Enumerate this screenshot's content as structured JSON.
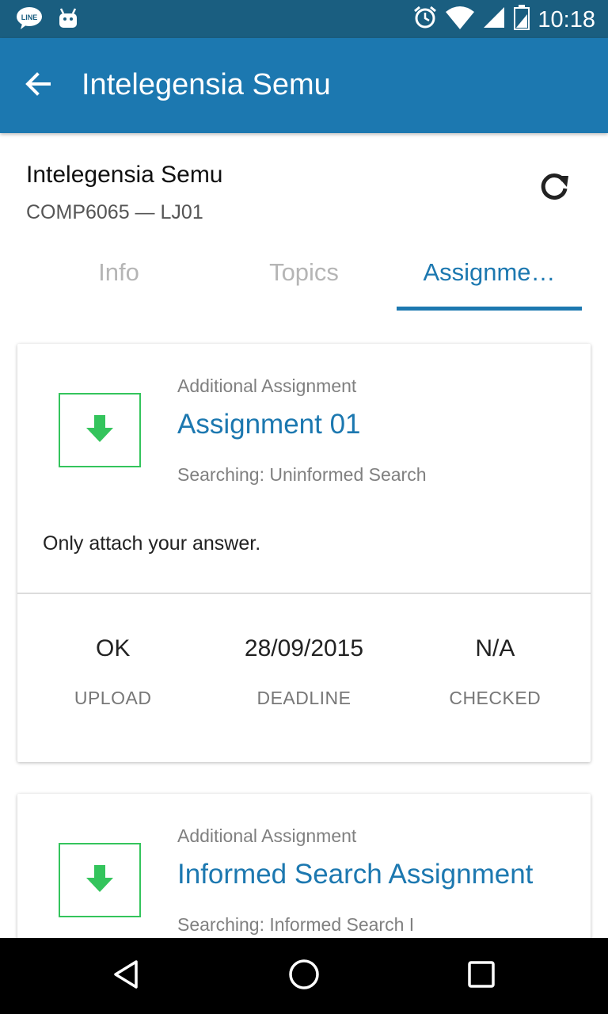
{
  "status_bar": {
    "time": "10:18",
    "left_icons": [
      "line-app-icon",
      "android-notification-icon"
    ],
    "right_icons": [
      "alarm-icon",
      "wifi-icon",
      "cell-signal-icon",
      "battery-icon"
    ],
    "line_badge": "LINE"
  },
  "app_bar": {
    "title": "Intelegensia Semu",
    "back_icon": "arrow-back-icon"
  },
  "course": {
    "title": "Intelegensia Semu",
    "subtitle": "COMP6065 — LJ01",
    "refresh_icon": "refresh-icon"
  },
  "tabs": [
    {
      "label": "Info",
      "active": false
    },
    {
      "label": "Topics",
      "active": false
    },
    {
      "label": "Assignme…",
      "active": true
    }
  ],
  "assignments": [
    {
      "kind": "Additional Assignment",
      "title": "Assignment 01",
      "topic": "Searching: Uninformed Search",
      "note": "Only attach your answer.",
      "stats": [
        {
          "value": "OK",
          "label": "UPLOAD"
        },
        {
          "value": "28/09/2015",
          "label": "DEADLINE"
        },
        {
          "value": "N/A",
          "label": "CHECKED"
        }
      ]
    },
    {
      "kind": "Additional Assignment",
      "title": "Informed Search Assignment",
      "topic": "Searching: Informed Search I"
    }
  ],
  "colors": {
    "status_bar": "#1a5e80",
    "app_bar": "#1c78b0",
    "accent": "#1c78b0",
    "download_green": "#34c45c",
    "tab_inactive": "#b5b5b5"
  },
  "nav_bar": {
    "buttons": [
      "back-triangle-icon",
      "home-circle-icon",
      "recents-square-icon"
    ]
  }
}
